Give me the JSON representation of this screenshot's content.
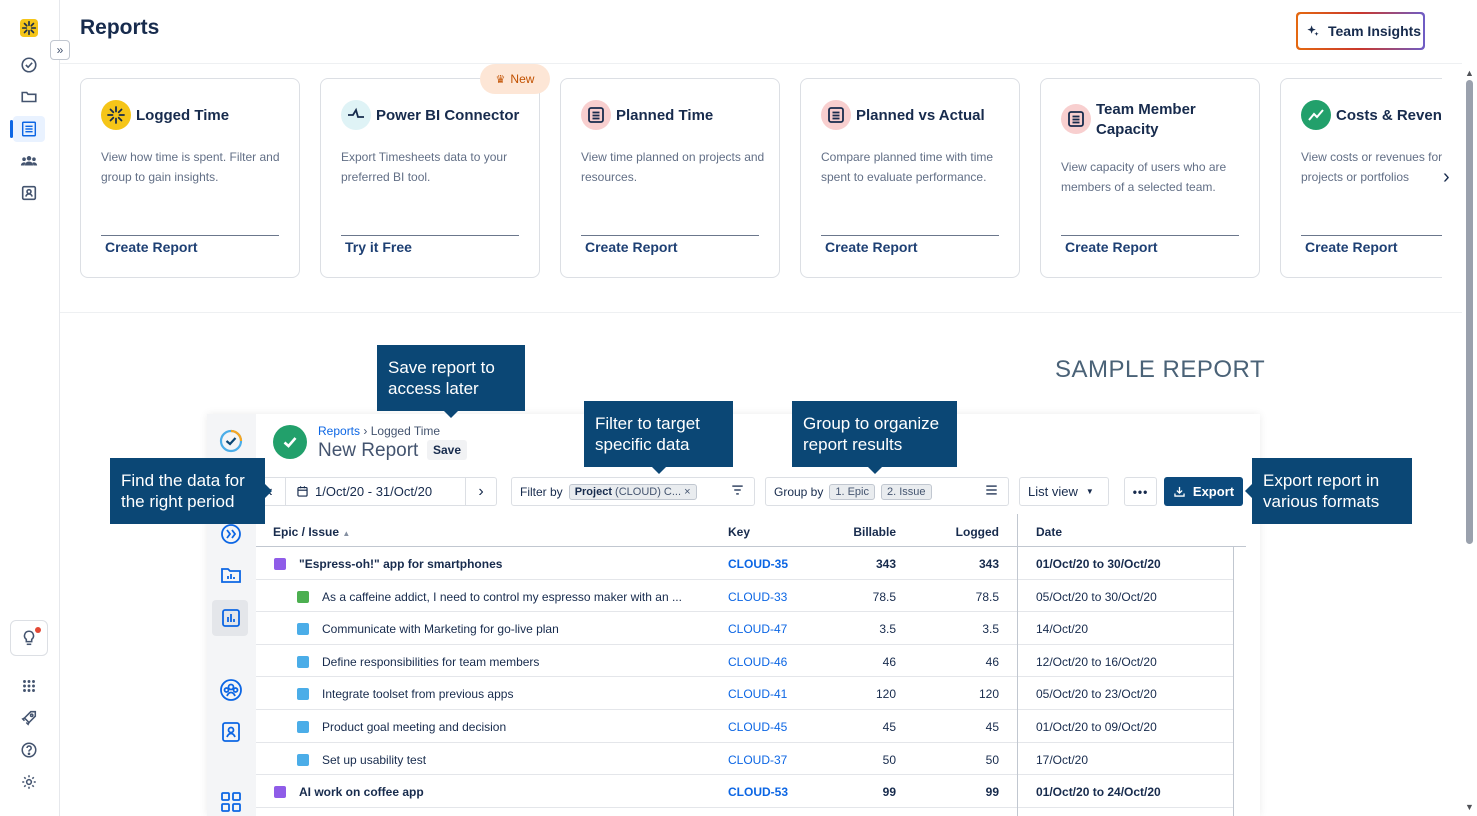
{
  "page": {
    "title": "Reports"
  },
  "header": {
    "team_insights_label": "Team Insights"
  },
  "cards": [
    {
      "title": "Logged Time",
      "description": "View how time is spent. Filter and group to gain insights.",
      "link": "Create Report"
    },
    {
      "title": "Power BI Connector",
      "description": "Export Timesheets data to your preferred BI tool.",
      "link": "Try it Free",
      "badge": "New"
    },
    {
      "title": "Planned Time",
      "description": "View time planned on projects and resources.",
      "link": "Create Report"
    },
    {
      "title": "Planned vs Actual",
      "description": "Compare planned time with time spent to evaluate performance.",
      "link": "Create Report"
    },
    {
      "title": "Team Member Capacity",
      "description": "View capacity of users who are members of a selected team.",
      "link": "Create Report"
    },
    {
      "title": "Costs & Revenu",
      "description": "View costs or revenues for projects or portfolios",
      "link": "Create Report"
    }
  ],
  "sample": {
    "heading": "SAMPLE REPORT",
    "breadcrumb_root": "Reports",
    "breadcrumb_separator": "›",
    "breadcrumb_current": "Logged Time",
    "title": "New Report",
    "save_label": "Save",
    "date_range": "1/Oct/20 - 31/Oct/20",
    "filter_label": "Filter by",
    "filter_chip_key": "Project",
    "filter_chip_value": "(CLOUD) C...",
    "group_label": "Group by",
    "group_chip_1": "1. Epic",
    "group_chip_2": "2. Issue",
    "view_label": "List view",
    "more_label": "•••",
    "export_label": "Export",
    "columns": {
      "issue": "Epic / Issue",
      "key": "Key",
      "billable": "Billable",
      "logged": "Logged",
      "date": "Date"
    },
    "rows": [
      {
        "type": "epic",
        "issue": "\"Espress-oh!\" app for smartphones",
        "key": "CLOUD-35",
        "billable": "343",
        "logged": "343",
        "date": "01/Oct/20 to 30/Oct/20"
      },
      {
        "type": "story",
        "issue": "As a caffeine addict, I need to control my espresso maker with an ...",
        "key": "CLOUD-33",
        "billable": "78.5",
        "logged": "78.5",
        "date": "05/Oct/20 to 30/Oct/20"
      },
      {
        "type": "task",
        "issue": "Communicate with Marketing for go-live plan",
        "key": "CLOUD-47",
        "billable": "3.5",
        "logged": "3.5",
        "date": "14/Oct/20"
      },
      {
        "type": "task",
        "issue": "Define responsibilities for team members",
        "key": "CLOUD-46",
        "billable": "46",
        "logged": "46",
        "date": "12/Oct/20 to 16/Oct/20"
      },
      {
        "type": "task",
        "issue": "Integrate toolset from previous apps",
        "key": "CLOUD-41",
        "billable": "120",
        "logged": "120",
        "date": "05/Oct/20 to 23/Oct/20"
      },
      {
        "type": "task",
        "issue": "Product goal meeting and decision",
        "key": "CLOUD-45",
        "billable": "45",
        "logged": "45",
        "date": "01/Oct/20 to 09/Oct/20"
      },
      {
        "type": "task",
        "issue": "Set up usability test",
        "key": "CLOUD-37",
        "billable": "50",
        "logged": "50",
        "date": "17/Oct/20"
      },
      {
        "type": "epic",
        "issue": "AI work on coffee app",
        "key": "CLOUD-53",
        "billable": "99",
        "logged": "99",
        "date": "01/Oct/20 to 24/Oct/20"
      }
    ]
  },
  "tooltips": {
    "save": "Save report to access later",
    "filter": "Filter to target specific data",
    "group": "Group to organize report results",
    "period": "Find the data for the right period",
    "export": "Export report in various formats"
  },
  "colors": {
    "accent": "#0c66e4",
    "tooltip_bg": "#0b4775",
    "export_bg": "#0c4a7d",
    "epic": "#8f5ce8",
    "story": "#4caf50",
    "task": "#4bade8"
  }
}
